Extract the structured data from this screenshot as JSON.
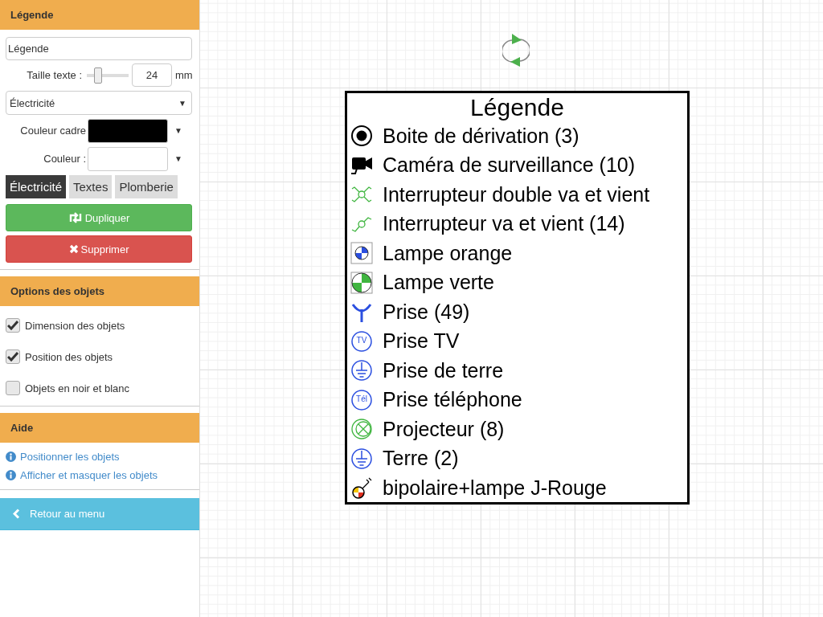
{
  "sidebar": {
    "sections": [
      {
        "title": "Légende",
        "kind": "legend-editor"
      },
      {
        "title": "Options des objets",
        "kind": "options"
      },
      {
        "title": "Aide",
        "kind": "help"
      }
    ],
    "legend_editor": {
      "name_field": {
        "value": "Légende"
      },
      "text_size": {
        "label": "Taille texte :",
        "level": 0.2,
        "value": "24",
        "unit": "mm"
      },
      "category_select": {
        "value": "Électricité",
        "caret": "▼"
      },
      "frame_color": {
        "label": "Couleur cadre",
        "color": "#000000",
        "caret": "▼"
      },
      "fill_color": {
        "label": "Couleur :",
        "color": "#ffffff",
        "caret": "▼"
      },
      "tabs": [
        {
          "label": "Électricité",
          "selected": true
        },
        {
          "label": "Textes",
          "selected": false
        },
        {
          "label": "Plomberie",
          "selected": false
        }
      ],
      "duplicate_button": "Dupliquer",
      "delete_button": "Supprimer"
    },
    "options": [
      {
        "label": "Dimension des objets",
        "checked": true
      },
      {
        "label": "Position des objets",
        "checked": true
      },
      {
        "label": "Objets en noir et blanc",
        "checked": false
      }
    ],
    "help_links": [
      "Positionner les objets",
      "Afficher et masquer les objets"
    ],
    "back_button": "Retour au menu"
  },
  "legend": {
    "title": "Légende",
    "items": [
      {
        "kind": "junction-box",
        "label": "Boite de dérivation (3)"
      },
      {
        "kind": "camera",
        "label": "Caméra de surveillance (10)"
      },
      {
        "kind": "double-switch",
        "label": "Interrupteur double va et vient"
      },
      {
        "kind": "switch",
        "label": "Interrupteur va et vient (14)"
      },
      {
        "kind": "lamp-blue",
        "label": "Lampe orange"
      },
      {
        "kind": "lamp-green",
        "label": "Lampe verte"
      },
      {
        "kind": "socket",
        "label": "Prise (49)"
      },
      {
        "kind": "socket-text",
        "icon_text": "TV",
        "label": "Prise TV"
      },
      {
        "kind": "earth",
        "label": "Prise de terre"
      },
      {
        "kind": "socket-text",
        "icon_text": "Tél",
        "label": "Prise téléphone"
      },
      {
        "kind": "projector",
        "label": "Projecteur (8)"
      },
      {
        "kind": "earth",
        "label": "Terre (2)"
      },
      {
        "kind": "bipolar-lamp",
        "label": "bipolaire+lampe J-Rouge"
      }
    ]
  }
}
